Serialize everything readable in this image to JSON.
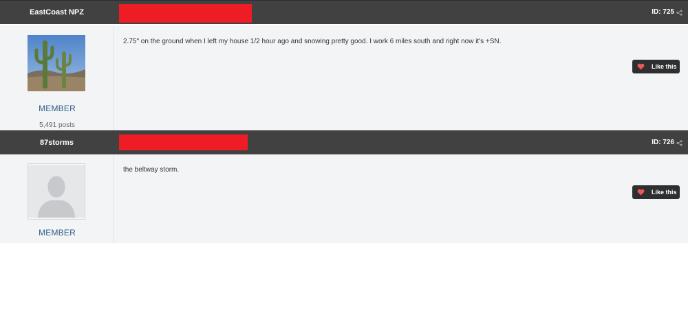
{
  "posts": [
    {
      "author": "EastCoast NPZ",
      "post_id": "ID: 725",
      "role": "MEMBER",
      "post_count": "5,491 posts",
      "text": "2.75\" on the ground when I left my house 1/2 hour ago and snowing pretty good.  I work 6 miles south and right now it's +SN.",
      "like_label": "Like this",
      "avatar": "saguaro-cactus-photo"
    },
    {
      "author": "87storms",
      "post_id": "ID: 726",
      "role": "MEMBER",
      "text": "the beltway storm.",
      "like_label": "Like this",
      "avatar": "default-user-silhouette"
    }
  ],
  "colors": {
    "header_bg": "#414141",
    "body_bg": "#f3f4f6",
    "redaction": "#ee1c25",
    "role_text": "#2f5d8c",
    "like_button": "#2f2f2f",
    "heart": "#e8585b"
  },
  "icons": [
    "share-icon",
    "heart-icon"
  ]
}
